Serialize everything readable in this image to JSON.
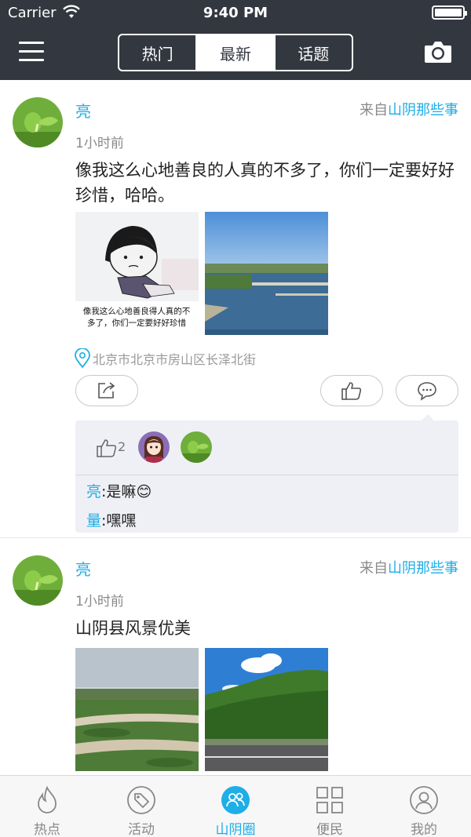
{
  "status_bar": {
    "carrier": "Carrier",
    "time": "9:40 PM"
  },
  "header": {
    "tabs": [
      {
        "label": "热门",
        "active": false
      },
      {
        "label": "最新",
        "active": true
      },
      {
        "label": "话题",
        "active": false
      }
    ],
    "menu_icon": "hamburger-icon",
    "camera_icon": "camera-icon"
  },
  "posts": [
    {
      "username": "亮",
      "source_prefix": "来自",
      "source_name": "山阴那些事",
      "time_ago": "1小时前",
      "content": "像我这么心地善良的人真的不多了，你们一定要好好珍惜，哈哈。",
      "images": [
        {
          "type": "meme",
          "caption": "像我这么心地善良得人真的不多了，你们一定要好好珍惜"
        },
        {
          "type": "lake"
        }
      ],
      "location": "北京市北京市房山区长泽北街",
      "likes": {
        "count": "2"
      },
      "comments": [
        {
          "user": "亮",
          "sep": ":",
          "text": "是嘛",
          "emoji": "😊"
        },
        {
          "user": "量",
          "sep": ":",
          "text": "嘿嘿",
          "emoji": ""
        }
      ]
    },
    {
      "username": "亮",
      "source_prefix": "来自",
      "source_name": "山阴那些事",
      "time_ago": "1小时前",
      "content": "山阴县风景优美",
      "images": [
        {
          "type": "garden"
        },
        {
          "type": "hill"
        }
      ]
    }
  ],
  "tabbar": {
    "items": [
      {
        "label": "热点",
        "icon": "flame-icon",
        "active": false
      },
      {
        "label": "活动",
        "icon": "tag-icon",
        "active": false
      },
      {
        "label": "山阴圈",
        "icon": "people-icon",
        "active": true
      },
      {
        "label": "便民",
        "icon": "grid-icon",
        "active": false
      },
      {
        "label": "我的",
        "icon": "user-icon",
        "active": false
      }
    ]
  },
  "colors": {
    "accent": "#1eaee8",
    "header_bg": "#333840",
    "likes_bg": "#eff0f5"
  }
}
